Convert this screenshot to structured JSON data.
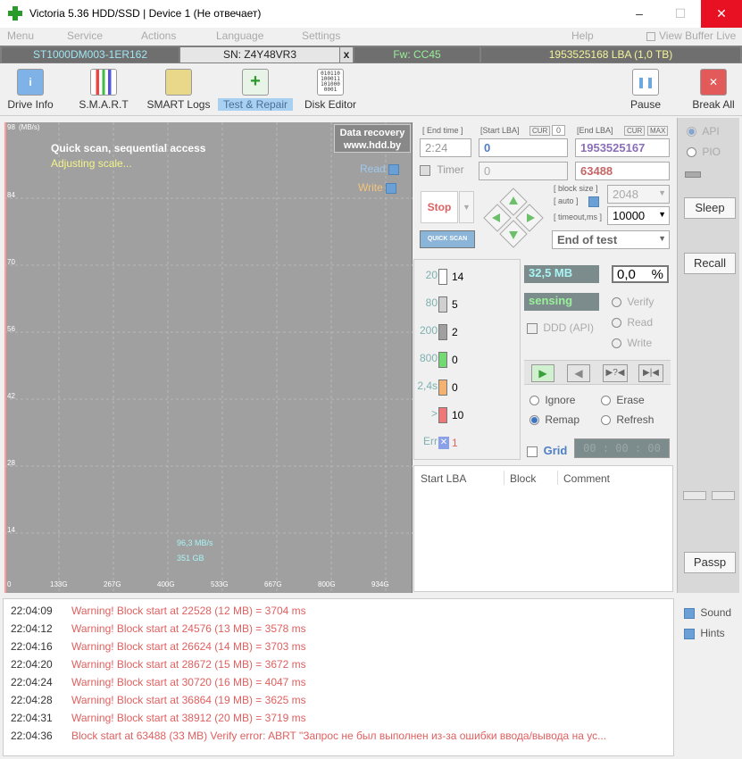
{
  "window": {
    "title": "Victoria 5.36 HDD/SSD | Device 1 (Не отвечает)"
  },
  "menu": {
    "items": [
      "Menu",
      "Service",
      "Actions",
      "Language",
      "Settings",
      "Help"
    ],
    "view_buffer": "View Buffer Live"
  },
  "info": {
    "model": "ST1000DM003-1ER162",
    "serial": "SN: Z4Y48VR3",
    "close": "x",
    "firmware": "Fw: CC45",
    "lba": "1953525168 LBA (1,0 TB)"
  },
  "toolbar": {
    "drive_info": "Drive Info",
    "smart": "S.M.A.R.T",
    "smart_logs": "SMART Logs",
    "test_repair": "Test & Repair",
    "disk_editor": "Disk Editor",
    "pause": "Pause",
    "break_all": "Break All"
  },
  "graph": {
    "unit": "(MB/s)",
    "title": "Quick scan, sequential access",
    "subtitle": "Adjusting scale...",
    "read": "Read",
    "write": "Write",
    "recovery1": "Data recovery",
    "recovery2": "www.hdd.by",
    "speed": "96,3 MB/s",
    "position": "351 GB",
    "y_ticks": [
      "98",
      "84",
      "70",
      "56",
      "42",
      "28",
      "14",
      "0"
    ],
    "x_ticks": [
      "133G",
      "267G",
      "400G",
      "533G",
      "667G",
      "800G",
      "934G"
    ]
  },
  "controls": {
    "end_time": "[ End time ]",
    "end_time_value": "2:24",
    "timer": "Timer",
    "start_lba_label": "[Start LBA]",
    "cur": "CUR",
    "start_cur": "0",
    "start_lba": "0",
    "timer_value": "0",
    "end_lba_label": "[End LBA]",
    "max": "MAX",
    "end_lba": "1953525167",
    "end_value": "63488",
    "stop": "Stop",
    "quick_scan": "QUICK SCAN",
    "block_size": "[ block size ]",
    "auto": "[ auto ]",
    "block_value": "2048",
    "timeout": "[ timeout,ms ]",
    "timeout_value": "10000",
    "end_mode": "End of test"
  },
  "stats": {
    "rows": [
      {
        "label": "20",
        "value": "14",
        "color": "#ffffff"
      },
      {
        "label": "80",
        "value": "5",
        "color": "#d0d0d0"
      },
      {
        "label": "200",
        "value": "2",
        "color": "#a0a0a0"
      },
      {
        "label": "800",
        "value": "0",
        "color": "#74d874"
      },
      {
        "label": "2,4s",
        "value": "0",
        "color": "#f4b272"
      },
      {
        "label": ">",
        "value": "10",
        "color": "#ee7777"
      },
      {
        "label": "Err",
        "value": "1",
        "color": "#8aa0e8"
      }
    ]
  },
  "progress": {
    "size": "32,5 MB",
    "percent": "0,0",
    "percent_sign": "%",
    "status": "sensing",
    "ddd": "DDD (API)",
    "verify": "Verify",
    "read": "Read",
    "write": "Write"
  },
  "actions": {
    "ignore": "Ignore",
    "erase": "Erase",
    "remap": "Remap",
    "refresh": "Refresh",
    "grid": "Grid",
    "timer": "00 : 00 : 00"
  },
  "bad_list": {
    "col_start": "Start LBA",
    "col_block": "Block",
    "col_comment": "Comment"
  },
  "side": {
    "api": "API",
    "pio": "PIO",
    "sleep": "Sleep",
    "recall": "Recall",
    "passp": "Passp"
  },
  "log": {
    "rows": [
      {
        "time": "22:04:09",
        "msg": "Warning! Block start at 22528 (12 MB)  = 3704 ms"
      },
      {
        "time": "22:04:12",
        "msg": "Warning! Block start at 24576 (13 MB)  = 3578 ms"
      },
      {
        "time": "22:04:16",
        "msg": "Warning! Block start at 26624 (14 MB)  = 3703 ms"
      },
      {
        "time": "22:04:20",
        "msg": "Warning! Block start at 28672 (15 MB)  = 3672 ms"
      },
      {
        "time": "22:04:24",
        "msg": "Warning! Block start at 30720 (16 MB)  = 4047 ms"
      },
      {
        "time": "22:04:28",
        "msg": "Warning! Block start at 36864 (19 MB)  = 3625 ms"
      },
      {
        "time": "22:04:31",
        "msg": "Warning! Block start at 38912 (20 MB)  = 3719 ms"
      },
      {
        "time": "22:04:36",
        "msg": "Block start at 63488 (33 MB) Verify error: ABRT \"Запрос не был выполнен из-за ошибки ввода/вывода на ус..."
      }
    ],
    "sound": "Sound",
    "hints": "Hints"
  }
}
